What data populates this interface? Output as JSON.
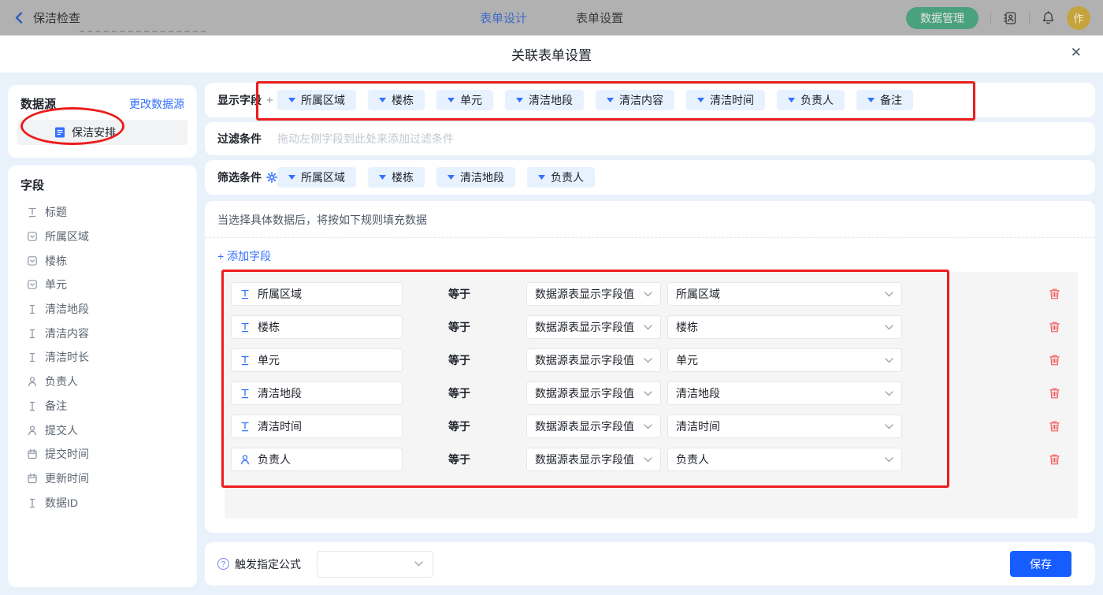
{
  "topbar": {
    "back_label": "保洁检查",
    "tabs": [
      {
        "label": "表单设计",
        "active": true
      },
      {
        "label": "表单设置",
        "active": false
      }
    ],
    "data_manage_label": "数据管理",
    "avatar_text": "作"
  },
  "modal": {
    "title": "关联表单设置",
    "close_glyph": "✕"
  },
  "sidebar": {
    "datasource": {
      "title": "数据源",
      "change_link": "更改数据源",
      "selected_item": "保洁安排"
    },
    "fields": {
      "title": "字段",
      "items": [
        {
          "icon": "title-icon",
          "label": "标题"
        },
        {
          "icon": "select-icon",
          "label": "所属区域"
        },
        {
          "icon": "select-icon",
          "label": "楼栋"
        },
        {
          "icon": "select-icon",
          "label": "单元"
        },
        {
          "icon": "text-icon",
          "label": "清洁地段"
        },
        {
          "icon": "text-icon",
          "label": "清洁内容"
        },
        {
          "icon": "text-icon",
          "label": "清洁时长"
        },
        {
          "icon": "person-icon",
          "label": "负责人"
        },
        {
          "icon": "text-icon",
          "label": "备注"
        },
        {
          "icon": "person-icon",
          "label": "提交人"
        },
        {
          "icon": "calendar-icon",
          "label": "提交时间"
        },
        {
          "icon": "calendar-icon",
          "label": "更新时间"
        },
        {
          "icon": "text-icon",
          "label": "数据ID"
        }
      ]
    }
  },
  "main": {
    "display_fields": {
      "label": "显示字段",
      "add_glyph": "+",
      "tags": [
        "所属区域",
        "楼栋",
        "单元",
        "清洁地段",
        "清洁内容",
        "清洁时间",
        "负责人",
        "备注"
      ]
    },
    "filter": {
      "label": "过滤条件",
      "placeholder": "拖动左侧字段到此处来添加过滤条件"
    },
    "screening": {
      "label": "筛选条件",
      "tags": [
        "所属区域",
        "楼栋",
        "清洁地段",
        "负责人"
      ]
    },
    "rules": {
      "hint": "当选择具体数据后，将按如下规则填充数据",
      "add_field_label": "+ 添加字段",
      "operator": "等于",
      "rows": [
        {
          "icon": "title-icon",
          "field": "所属区域",
          "source": "数据源表显示字段值",
          "value": "所属区域"
        },
        {
          "icon": "title-icon",
          "field": "楼栋",
          "source": "数据源表显示字段值",
          "value": "楼栋"
        },
        {
          "icon": "title-icon",
          "field": "单元",
          "source": "数据源表显示字段值",
          "value": "单元"
        },
        {
          "icon": "title-icon",
          "field": "清洁地段",
          "source": "数据源表显示字段值",
          "value": "清洁地段"
        },
        {
          "icon": "title-icon",
          "field": "清洁时间",
          "source": "数据源表显示字段值",
          "value": "清洁时间"
        },
        {
          "icon": "person-icon",
          "field": "负责人",
          "source": "数据源表显示字段值",
          "value": "负责人"
        }
      ]
    },
    "footer": {
      "formula_label": "触发指定公式",
      "formula_value": "",
      "save_label": "保存"
    }
  },
  "colors": {
    "accent": "#3370ff",
    "tag_bg": "#e7f2fe",
    "annotation_red": "#ec1c1c",
    "trash_red": "#f45b5b",
    "save_blue": "#165dff",
    "green_button": "#4aa17d",
    "avatar_gold": "#c5a43f",
    "body_bg": "#e9f1fb"
  }
}
